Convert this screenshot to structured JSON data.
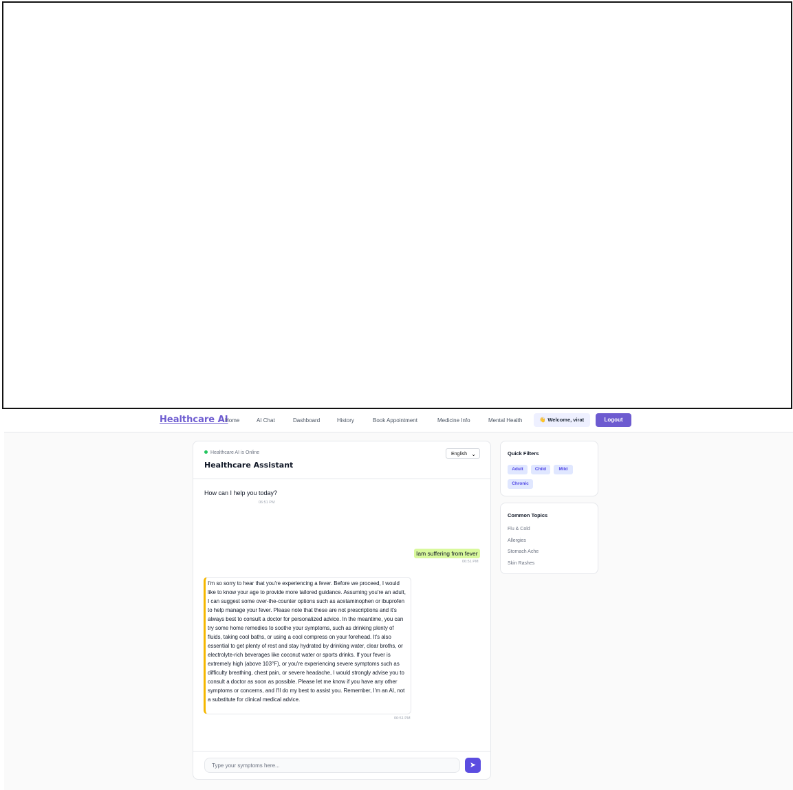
{
  "nav": {
    "brand": "Healthcare AI",
    "links": [
      "Home",
      "AI Chat",
      "Dashboard",
      "History",
      "Book Appointment",
      "Medicine Info",
      "Mental Health"
    ],
    "welcome": "Welcome, virat",
    "logout": "Logout"
  },
  "chat": {
    "status": "Healthcare AI is Online",
    "title": "Healthcare Assistant",
    "language": "English",
    "messages": [
      {
        "role": "bot",
        "text": "How can I help you today?",
        "time": "06:51 PM"
      },
      {
        "role": "user",
        "text": "Iam suffering from fever",
        "time": "06:51 PM"
      },
      {
        "role": "bot",
        "text": "I'm so sorry to hear that you're experiencing a fever. Before we proceed, I would like to know your age to provide more tailored guidance. Assuming you're an adult, I can suggest some over-the-counter options such as acetaminophen or ibuprofen to help manage your fever. Please note that these are not prescriptions and it's always best to consult a doctor for personalized advice. In the meantime, you can try some home remedies to soothe your symptoms, such as drinking plenty of fluids, taking cool baths, or using a cool compress on your forehead. It's also essential to get plenty of rest and stay hydrated by drinking water, clear broths, or electrolyte-rich beverages like coconut water or sports drinks. If your fever is extremely high (above 103°F), or you're experiencing severe symptoms such as difficulty breathing, chest pain, or severe headache, I would strongly advise you to consult a doctor as soon as possible. Please let me know if you have any other symptoms or concerns, and I'll do my best to assist you. Remember, I'm an AI, not a substitute for clinical medical advice.",
        "time": "06:51 PM"
      }
    ],
    "input_placeholder": "Type your symptoms here...",
    "send_icon": "send-icon"
  },
  "quick_filters": {
    "title": "Quick Filters",
    "chips": [
      "Adult",
      "Child",
      "Mild",
      "Chronic"
    ]
  },
  "common_topics": {
    "title": "Common Topics",
    "items": [
      "Flu & Cold",
      "Allergies",
      "Stomach Ache",
      "Skin Rashes"
    ]
  },
  "colors": {
    "accent": "#6d5bd0",
    "user_bubble": "#d9f99d",
    "bot_border": "#f5b700",
    "online": "#22c55e"
  }
}
